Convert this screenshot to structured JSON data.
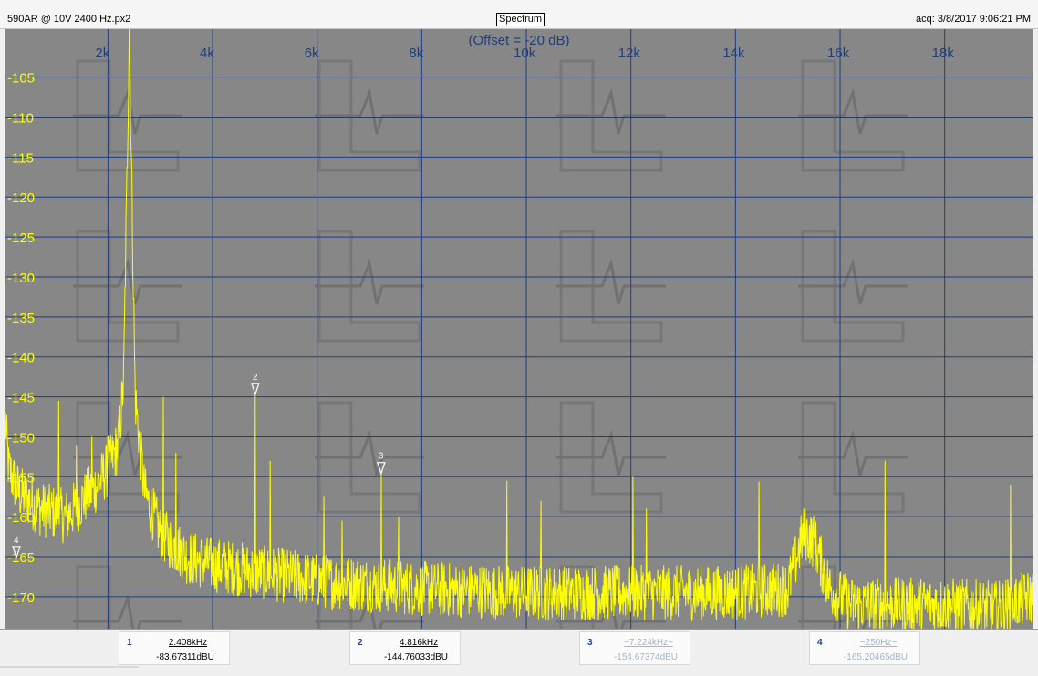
{
  "window": {
    "file_title": "590AR @ 10V 2400 Hz.px2",
    "view_label": "Spectrum",
    "acq_stamp": "acq: 3/8/2017 9:06:21 PM"
  },
  "plot": {
    "offset_label": "(Offset = -20 dB)",
    "x_tick_labels": [
      "2k",
      "4k",
      "6k",
      "8k",
      "10k",
      "12k",
      "14k",
      "16k",
      "18k"
    ],
    "y_tick_labels": [
      "-105",
      "-110",
      "-115",
      "-120",
      "-125",
      "-130",
      "-135",
      "-140",
      "-145",
      "-150",
      "-155",
      "-160",
      "-165",
      "-170"
    ],
    "watermark": "logo-watermark-tiles",
    "colors": {
      "background": "#878787",
      "grid": "#1e3e80",
      "trace": "#ffff00",
      "marker": "#ffffff",
      "y_labels": "#ffff00",
      "x_labels": "#1e3e80"
    }
  },
  "chart_data": {
    "type": "line",
    "title": "",
    "xlabel": "",
    "ylabel": "",
    "xlim": [
      40,
      19680
    ],
    "ylim": [
      -174,
      -99
    ],
    "x_ticks": [
      2000,
      4000,
      6000,
      8000,
      10000,
      12000,
      14000,
      16000,
      18000
    ],
    "y_ticks": [
      -105,
      -110,
      -115,
      -120,
      -125,
      -130,
      -135,
      -140,
      -145,
      -150,
      -155,
      -160,
      -165,
      -170
    ],
    "grid": true,
    "series": [
      {
        "name": "",
        "color": "#ffff00",
        "noise_floor": [
          [
            40,
            -148
          ],
          [
            100,
            -154
          ],
          [
            300,
            -157
          ],
          [
            700,
            -159
          ],
          [
            1200,
            -160
          ],
          [
            1800,
            -156
          ],
          [
            2000,
            -154
          ],
          [
            2200,
            -151
          ],
          [
            2300,
            -143
          ],
          [
            2408,
            -99
          ],
          [
            2520,
            -145
          ],
          [
            2700,
            -157
          ],
          [
            3000,
            -162
          ],
          [
            3500,
            -165
          ],
          [
            4000,
            -166
          ],
          [
            5000,
            -167
          ],
          [
            6000,
            -168
          ],
          [
            7000,
            -168.5
          ],
          [
            8000,
            -169
          ],
          [
            10000,
            -169.5
          ],
          [
            12000,
            -169.5
          ],
          [
            14000,
            -169.5
          ],
          [
            15000,
            -169
          ],
          [
            15300,
            -162
          ],
          [
            15500,
            -163
          ],
          [
            15800,
            -169
          ],
          [
            16200,
            -171
          ],
          [
            17000,
            -171
          ],
          [
            18000,
            -171
          ],
          [
            19000,
            -171.5
          ],
          [
            19680,
            -170
          ]
        ],
        "spurs": [
          [
            1060,
            -145.5
          ],
          [
            1400,
            -151
          ],
          [
            1690,
            -150
          ],
          [
            2000,
            -150
          ],
          [
            2200,
            -148
          ],
          [
            2408,
            -99
          ],
          [
            3060,
            -145
          ],
          [
            3300,
            -152
          ],
          [
            4816,
            -144.8
          ],
          [
            5100,
            -153
          ],
          [
            6130,
            -157.4
          ],
          [
            6480,
            -160.5
          ],
          [
            7224,
            -154.7
          ],
          [
            7560,
            -160
          ],
          [
            9630,
            -155.5
          ],
          [
            10280,
            -158
          ],
          [
            12040,
            -155
          ],
          [
            12300,
            -159
          ],
          [
            14450,
            -155.6
          ],
          [
            16860,
            -153
          ],
          [
            19260,
            -156
          ]
        ]
      }
    ],
    "markers": [
      {
        "id": "1",
        "freq": "2.408kHz",
        "level": "-83.67311dBU",
        "active": true,
        "x": 2408
      },
      {
        "id": "2",
        "freq": "4.816kHz",
        "level": "-144.76033dBU",
        "active": true,
        "x": 4816,
        "y": -144.8
      },
      {
        "id": "3",
        "freq": "~7.224kHz~",
        "level": "-154.67374dBU",
        "active": false,
        "x": 7224,
        "y": -154.7
      },
      {
        "id": "4",
        "freq": "~250Hz~",
        "level": "-165.20465dBU",
        "active": false,
        "x": 250,
        "y": -165.2
      }
    ]
  },
  "footer": {
    "markers": [
      {
        "num": "1",
        "freq": "2.408kHz",
        "level": "-83.67311dBU"
      },
      {
        "num": "2",
        "freq": "4.816kHz",
        "level": "-144.76033dBU"
      },
      {
        "num": "3",
        "freq": "~7.224kHz~",
        "level": "-154.67374dBU"
      },
      {
        "num": "4",
        "freq": "~250Hz~",
        "level": "-165.20465dBU"
      }
    ]
  }
}
